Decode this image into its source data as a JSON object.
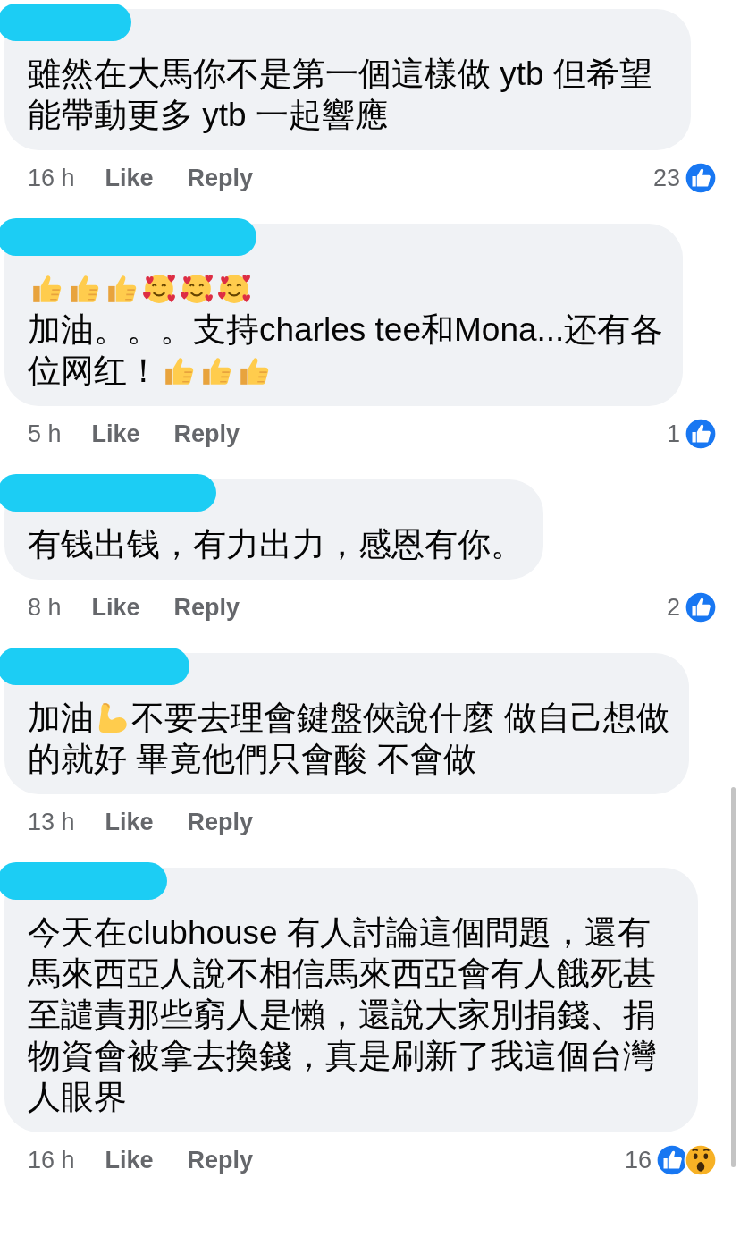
{
  "comments": [
    {
      "body": [
        {
          "kind": "text",
          "text": "雖然在大馬你不是第一個這樣做 ytb 但希望能帶動更多 ytb 一起響應"
        }
      ],
      "time": "16 h",
      "like": "Like",
      "reply": "Reply",
      "count": "23",
      "reactions": [
        {
          "kind": "like"
        }
      ]
    },
    {
      "body": [
        {
          "kind": "thumbs"
        },
        {
          "kind": "thumbs"
        },
        {
          "kind": "thumbs"
        },
        {
          "kind": "hearts"
        },
        {
          "kind": "hearts"
        },
        {
          "kind": "hearts"
        },
        {
          "kind": "break"
        },
        {
          "kind": "text",
          "text": "加油。。。支持charles tee和Mona...还有各"
        },
        {
          "kind": "break"
        },
        {
          "kind": "text",
          "text": "位网红！"
        },
        {
          "kind": "thumbs"
        },
        {
          "kind": "thumbs"
        },
        {
          "kind": "thumbs"
        }
      ],
      "time": "5 h",
      "like": "Like",
      "reply": "Reply",
      "count": "1",
      "reactions": [
        {
          "kind": "like"
        }
      ]
    },
    {
      "body": [
        {
          "kind": "text",
          "text": "有钱出钱，有力出力，感恩有你。"
        }
      ],
      "time": "8 h",
      "like": "Like",
      "reply": "Reply",
      "count": "2",
      "reactions": [
        {
          "kind": "like"
        }
      ]
    },
    {
      "body": [
        {
          "kind": "text",
          "text": "加油"
        },
        {
          "kind": "muscle"
        },
        {
          "kind": "text",
          "text": "不要去理會鍵盤俠說什麼 做自己想做"
        },
        {
          "kind": "break"
        },
        {
          "kind": "text",
          "text": "的就好 畢竟他們只會酸 不會做"
        }
      ],
      "time": "13 h",
      "like": "Like",
      "reply": "Reply"
    },
    {
      "body": [
        {
          "kind": "text",
          "text": "今天在clubhouse 有人討論這個問題，還有馬來西亞人說不相信馬來西亞會有人餓死甚至譴責那些窮人是懶，還說大家別捐錢、捐物資會被拿去換錢，真是刷新了我這個台灣人眼界"
        }
      ],
      "time": "16 h",
      "like": "Like",
      "reply": "Reply",
      "count": "16",
      "reactions": [
        {
          "kind": "like"
        },
        {
          "kind": "wow"
        }
      ]
    }
  ]
}
